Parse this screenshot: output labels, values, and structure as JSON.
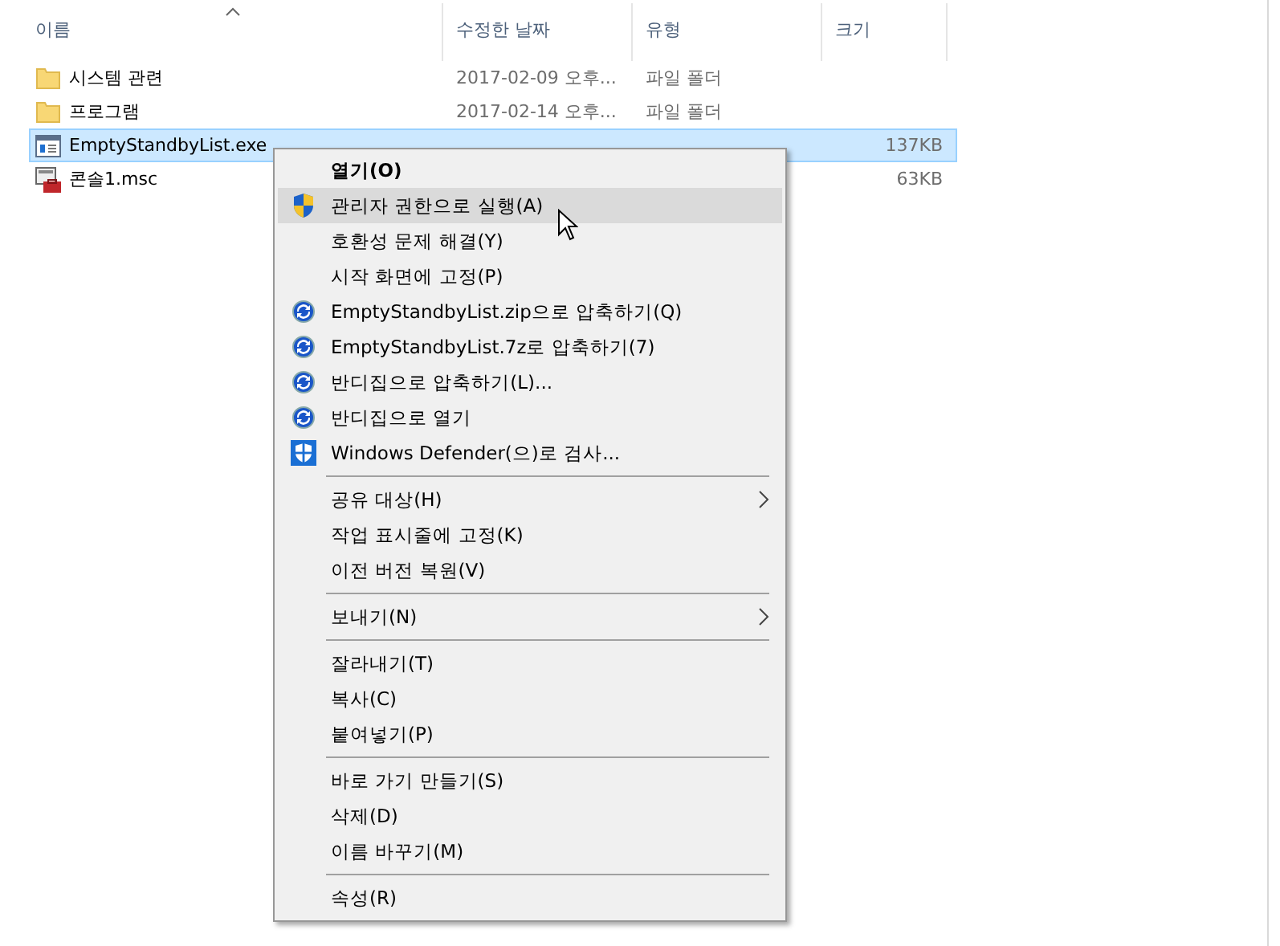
{
  "columns": [
    {
      "label": "이름",
      "sorted": true
    },
    {
      "label": "수정한 날짜",
      "sorted": false
    },
    {
      "label": "유형",
      "sorted": false
    },
    {
      "label": "크기",
      "sorted": false
    }
  ],
  "files": [
    {
      "kind": "folder",
      "name": "시스템 관련",
      "date": "2017-02-09 오후...",
      "type": "파일 폴더",
      "selected": false
    },
    {
      "kind": "folder",
      "name": "프로그램",
      "date": "2017-02-14 오후...",
      "type": "파일 폴더",
      "selected": false
    },
    {
      "kind": "exe",
      "name": "EmptyStandbyList.exe",
      "size": "137KB",
      "selected": true
    },
    {
      "kind": "msc",
      "name": "콘솔1.msc",
      "size": "63KB",
      "selected": false
    }
  ],
  "context_menu": {
    "items": [
      {
        "kind": "item",
        "label": "열기(O)",
        "default": true,
        "highlighted": false,
        "submenu": false
      },
      {
        "kind": "shield-item",
        "label": "관리자 권한으로 실행(A)",
        "default": false,
        "highlighted": true,
        "submenu": false
      },
      {
        "kind": "item",
        "label": "호환성 문제 해결(Y)",
        "default": false,
        "highlighted": false,
        "submenu": false
      },
      {
        "kind": "item",
        "label": "시작 화면에 고정(P)",
        "default": false,
        "highlighted": false,
        "submenu": false
      },
      {
        "kind": "archive-item",
        "label": "EmptyStandbyList.zip으로 압축하기(Q)",
        "default": false,
        "highlighted": false,
        "submenu": false
      },
      {
        "kind": "archive-item",
        "label": "EmptyStandbyList.7z로 압축하기(7)",
        "default": false,
        "highlighted": false,
        "submenu": false
      },
      {
        "kind": "archive-item",
        "label": "반디집으로 압축하기(L)...",
        "default": false,
        "highlighted": false,
        "submenu": false
      },
      {
        "kind": "archive-item",
        "label": "반디집으로 열기",
        "default": false,
        "highlighted": false,
        "submenu": false
      },
      {
        "kind": "defender-item",
        "label": "Windows Defender(으)로 검사...",
        "default": false,
        "highlighted": false,
        "submenu": false
      },
      {
        "kind": "separator"
      },
      {
        "kind": "item",
        "label": "공유 대상(H)",
        "default": false,
        "highlighted": false,
        "submenu": true
      },
      {
        "kind": "item",
        "label": "작업 표시줄에 고정(K)",
        "default": false,
        "highlighted": false,
        "submenu": false
      },
      {
        "kind": "item",
        "label": "이전 버전 복원(V)",
        "default": false,
        "highlighted": false,
        "submenu": false
      },
      {
        "kind": "separator"
      },
      {
        "kind": "item",
        "label": "보내기(N)",
        "default": false,
        "highlighted": false,
        "submenu": true
      },
      {
        "kind": "separator"
      },
      {
        "kind": "item",
        "label": "잘라내기(T)",
        "default": false,
        "highlighted": false,
        "submenu": false
      },
      {
        "kind": "item",
        "label": "복사(C)",
        "default": false,
        "highlighted": false,
        "submenu": false
      },
      {
        "kind": "item",
        "label": "붙여넣기(P)",
        "default": false,
        "highlighted": false,
        "submenu": false
      },
      {
        "kind": "separator"
      },
      {
        "kind": "item",
        "label": "바로 가기 만들기(S)",
        "default": false,
        "highlighted": false,
        "submenu": false
      },
      {
        "kind": "item",
        "label": "삭제(D)",
        "default": false,
        "highlighted": false,
        "submenu": false
      },
      {
        "kind": "item",
        "label": "이름 바꾸기(M)",
        "default": false,
        "highlighted": false,
        "submenu": false
      },
      {
        "kind": "separator"
      },
      {
        "kind": "item",
        "label": "속성(R)",
        "default": false,
        "highlighted": false,
        "submenu": false
      }
    ]
  }
}
